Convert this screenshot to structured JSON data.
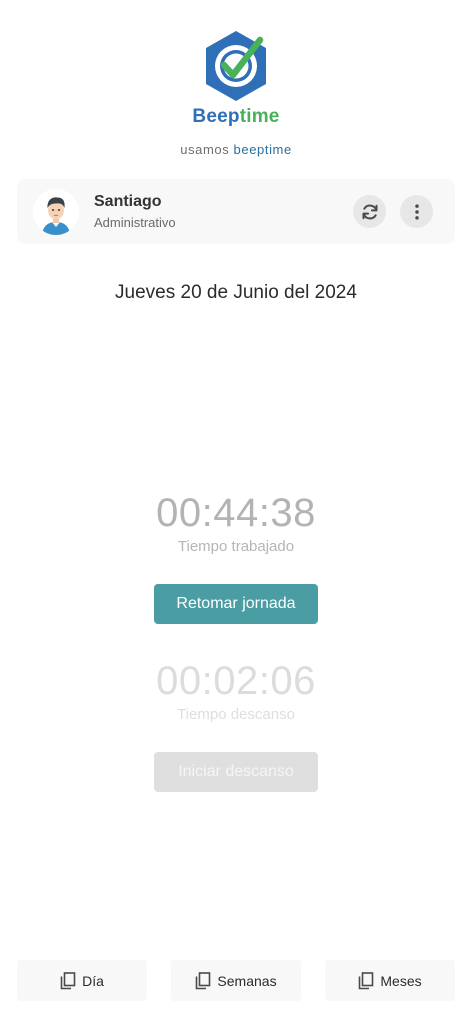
{
  "brand": {
    "name_part1": "Beep",
    "name_part2": "time",
    "tagline_prefix": "usamos",
    "tagline_accent": "beeptime",
    "colors": {
      "hexagon": "#2f6fb8",
      "check": "#49b15a",
      "accent": "#2a6fa0"
    }
  },
  "user": {
    "name": "Santiago",
    "role": "Administrativo",
    "avatar_icon": "user-avatar",
    "actions": [
      {
        "icon": "refresh-icon"
      },
      {
        "icon": "more-vertical-icon"
      }
    ]
  },
  "date": "Jueves 20 de Junio del 2024",
  "work": {
    "time": "00:44:38",
    "label": "Tiempo trabajado",
    "button": "Retomar jornada",
    "button_color": "#4a9da2"
  },
  "rest": {
    "time": "00:02:06",
    "label": "Tiempo descanso",
    "button": "Iniciar descanso",
    "button_state": "disabled"
  },
  "tabs": [
    {
      "label": "Día",
      "icon": "copy-icon"
    },
    {
      "label": "Semanas",
      "icon": "copy-icon"
    },
    {
      "label": "Meses",
      "icon": "copy-icon"
    }
  ]
}
